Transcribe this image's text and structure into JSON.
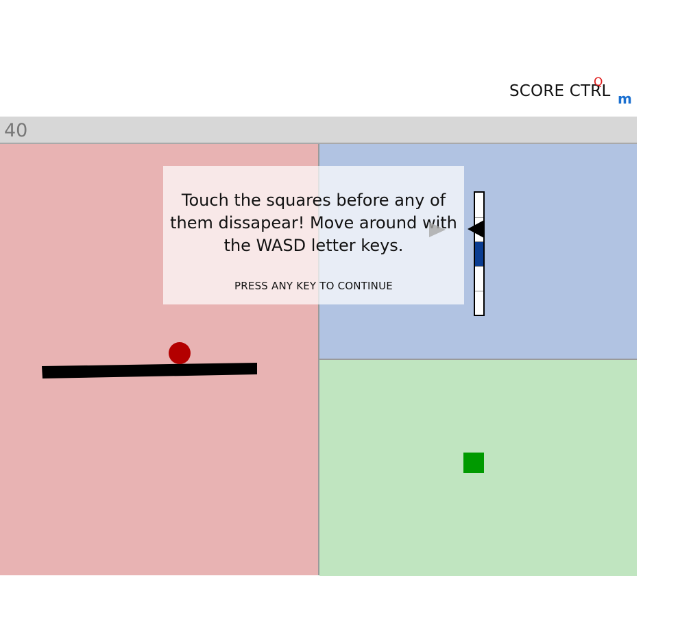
{
  "header": {
    "score_label": "SCORE CTRL",
    "score_superscript": "Q",
    "score_subscript": "m"
  },
  "timer": {
    "value": "40"
  },
  "overlay": {
    "message": "Touch the squares before any of them dissapear! Move around with the WASD letter keys.",
    "prompt": "PRESS ANY KEY TO CONTINUE"
  },
  "zones": {
    "red": {
      "color": "#e8b3b3",
      "objects": [
        "ball",
        "tilting-beam"
      ]
    },
    "blue": {
      "color": "#b1c3e2",
      "objects": [
        "vertical-gauge",
        "pointer"
      ]
    },
    "green": {
      "color": "#c0e5c0",
      "objects": [
        "target-square"
      ]
    }
  },
  "gauge": {
    "level_fraction": 0.45,
    "segments": 5
  },
  "colors": {
    "ball": "#b30000",
    "beam": "#000000",
    "target_square": "#009a00",
    "gauge_fill": "#0b3d91"
  }
}
